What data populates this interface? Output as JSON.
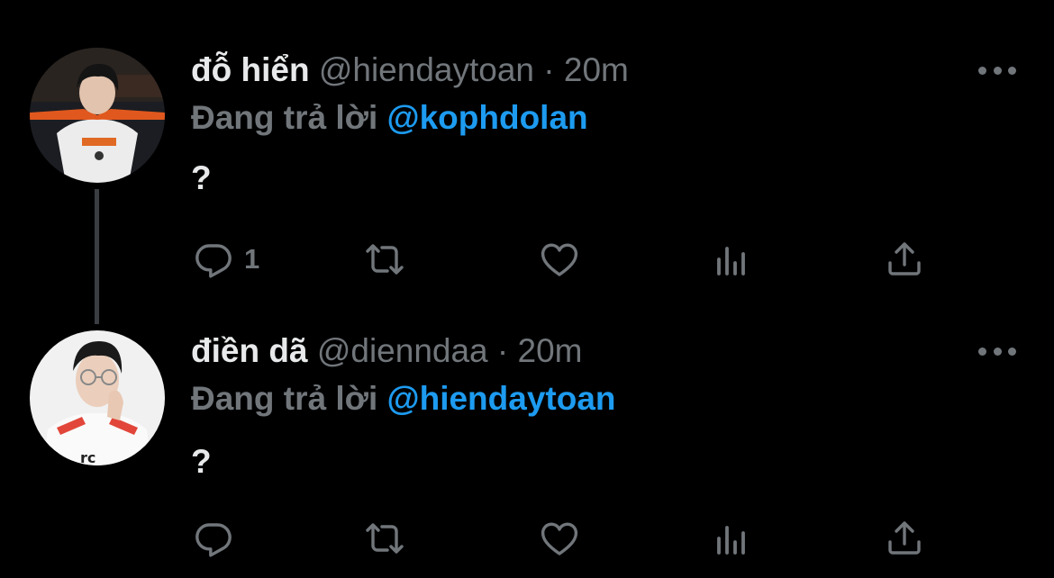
{
  "tweets": [
    {
      "display_name": "đỗ hiển",
      "handle": "@hiendaytoan",
      "separator": "·",
      "time": "20m",
      "reply_prefix": "Đang trả lời",
      "reply_to": "@kophdolan",
      "text": "?",
      "reply_count": "1"
    },
    {
      "display_name": "điền dã",
      "handle": "@dienndaa",
      "separator": "·",
      "time": "20m",
      "reply_prefix": "Đang trả lời",
      "reply_to": "@hiendaytoan",
      "text": "?",
      "reply_count": ""
    }
  ],
  "colors": {
    "background": "#000000",
    "primary_text": "#e7e9ea",
    "secondary_text": "#71767b",
    "link": "#1d9bf0",
    "thread_line": "#3a3d41"
  },
  "icons": [
    "reply-icon",
    "retweet-icon",
    "like-icon",
    "views-icon",
    "share-icon",
    "more-icon"
  ]
}
